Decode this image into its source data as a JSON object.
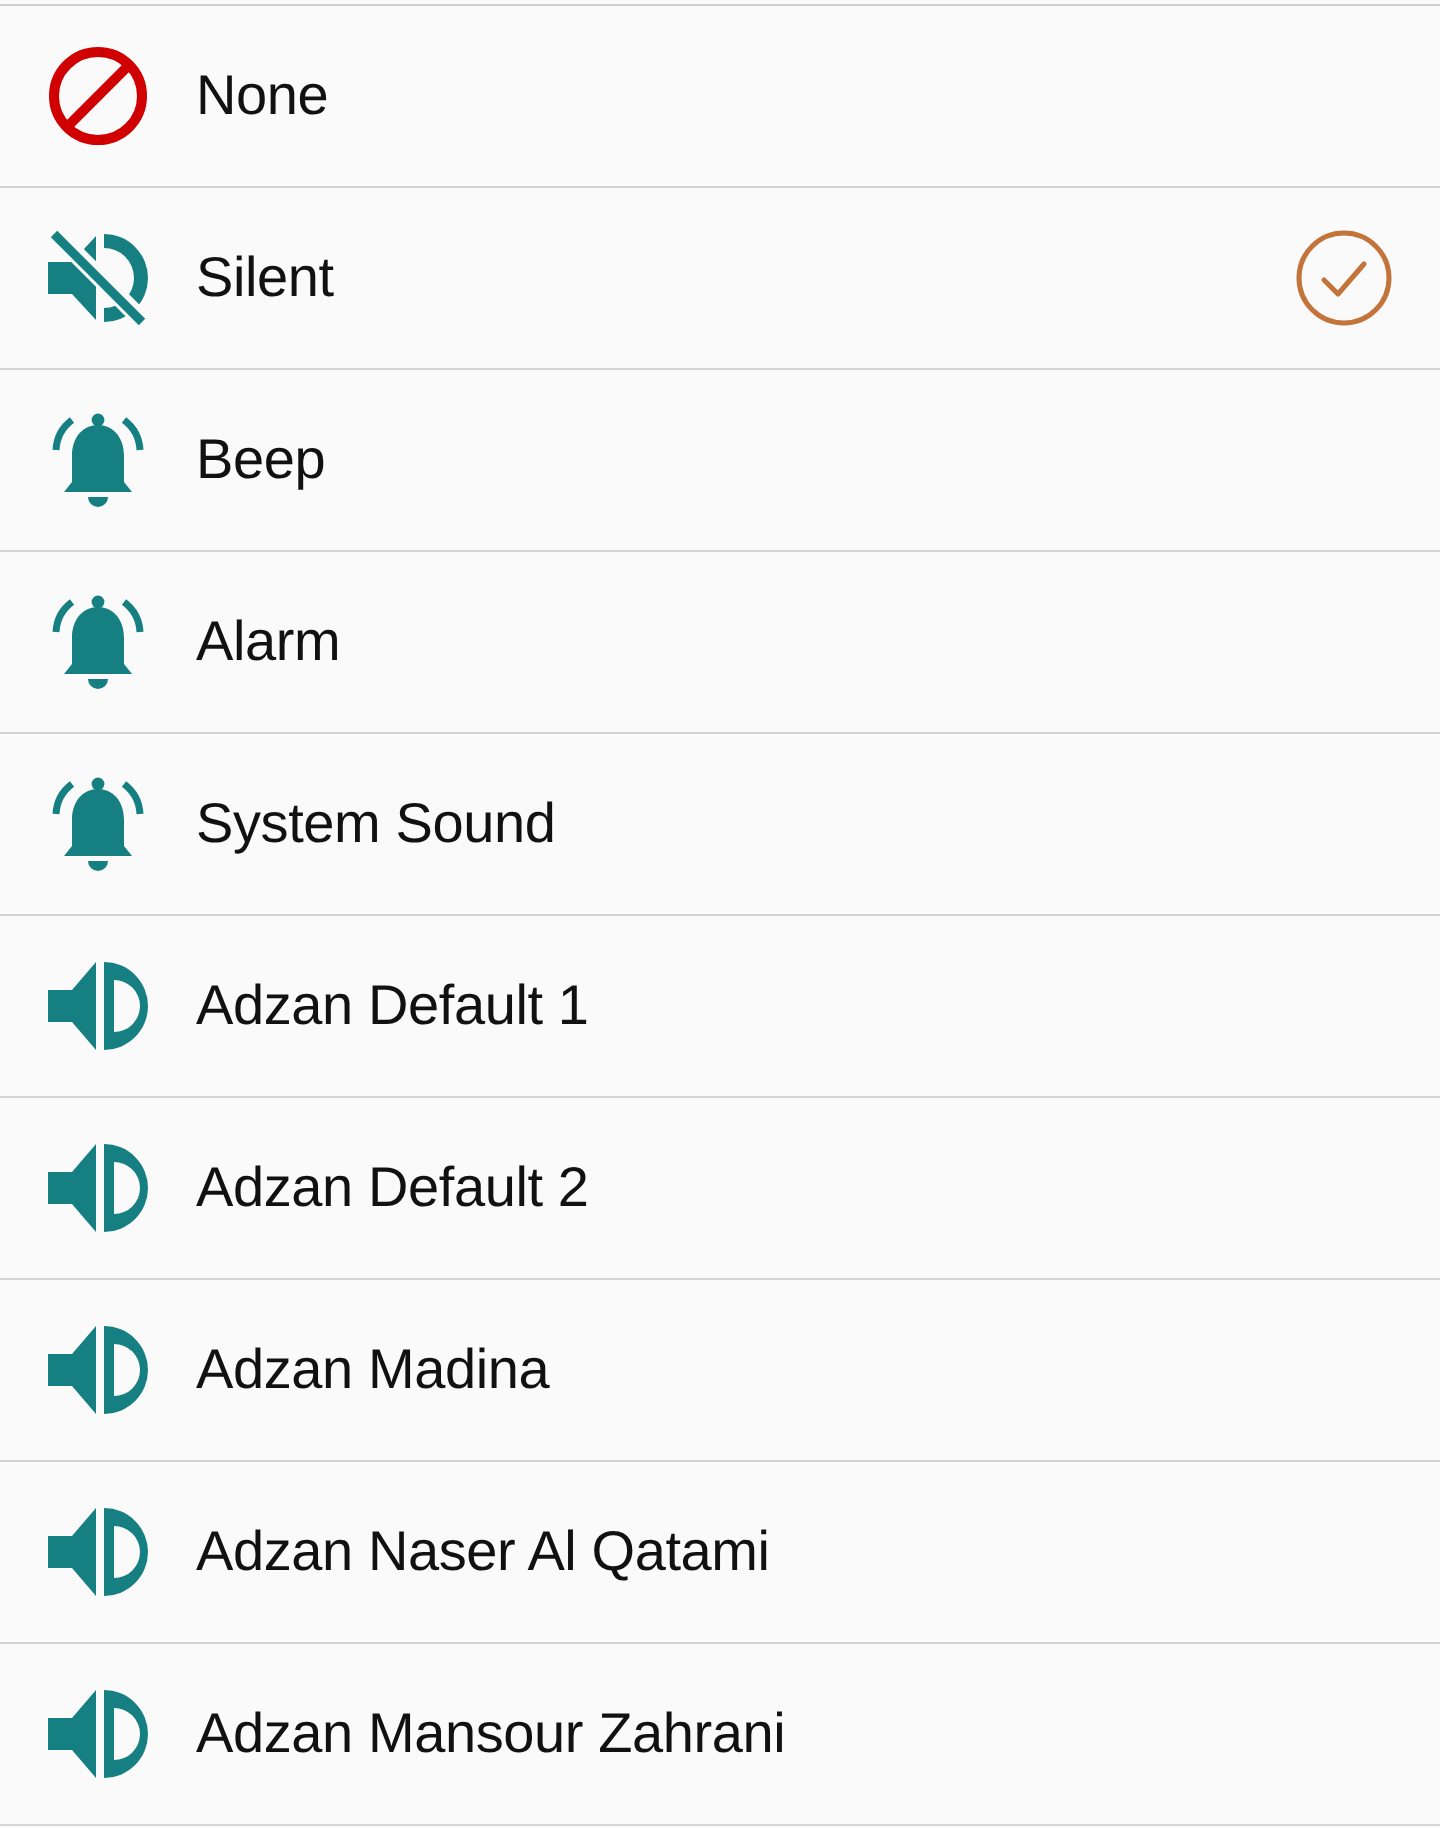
{
  "options": [
    {
      "kind": "none",
      "label": "None",
      "selected": false
    },
    {
      "kind": "silent",
      "label": "Silent",
      "selected": true
    },
    {
      "kind": "bell",
      "label": "Beep",
      "selected": false
    },
    {
      "kind": "bell",
      "label": "Alarm",
      "selected": false
    },
    {
      "kind": "bell",
      "label": "System Sound",
      "selected": false
    },
    {
      "kind": "speaker",
      "label": "Adzan Default 1",
      "selected": false
    },
    {
      "kind": "speaker",
      "label": "Adzan Default 2",
      "selected": false
    },
    {
      "kind": "speaker",
      "label": "Adzan Madina",
      "selected": false
    },
    {
      "kind": "speaker",
      "label": "Adzan Naser Al Qatami",
      "selected": false
    },
    {
      "kind": "speaker",
      "label": "Adzan Mansour Zahrani",
      "selected": false
    }
  ]
}
